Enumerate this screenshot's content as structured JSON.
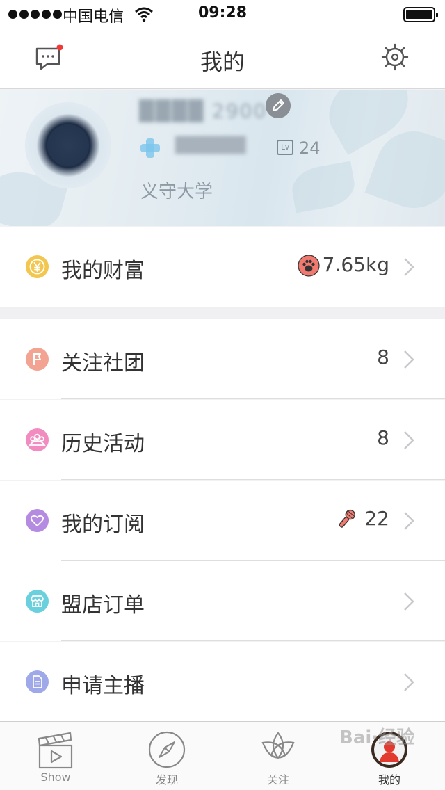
{
  "status_bar": {
    "carrier": "中国电信",
    "time": "09:28"
  },
  "nav": {
    "title": "我的",
    "left_icon": "message-icon",
    "right_icon": "settings-gear-icon"
  },
  "profile": {
    "nickname": "████ 2900",
    "uid": "██████",
    "level_badge": "Lv",
    "level": "24",
    "school": "义守大学"
  },
  "wealth": {
    "label": "我的财富",
    "value": "7.65kg",
    "icon": "yen-coin-icon",
    "value_icon": "paw-icon",
    "icon_color": "#f3c64f"
  },
  "menu": [
    {
      "key": "clubs",
      "label": "关注社团",
      "value": "8",
      "icon": "flag-icon",
      "color": "#f3a391"
    },
    {
      "key": "history",
      "label": "历史活动",
      "value": "8",
      "icon": "group-icon",
      "color": "#f28bc0"
    },
    {
      "key": "subscriptions",
      "label": "我的订阅",
      "value": "22",
      "icon": "heart-icon",
      "color": "#b48be0",
      "value_icon": "microphone-icon"
    },
    {
      "key": "store-orders",
      "label": "盟店订单",
      "value": "",
      "icon": "store-icon",
      "color": "#6ad0de"
    },
    {
      "key": "apply-host",
      "label": "申请主播",
      "value": "",
      "icon": "document-icon",
      "color": "#9fa8e8"
    }
  ],
  "tabs": [
    {
      "label": "Show",
      "icon": "clapperboard-icon"
    },
    {
      "label": "发现",
      "icon": "compass-icon"
    },
    {
      "label": "关注",
      "icon": "triquetra-icon"
    },
    {
      "label": "我的",
      "icon": "profile-avatar-icon",
      "active": true
    }
  ],
  "watermark": "Bai·经验"
}
